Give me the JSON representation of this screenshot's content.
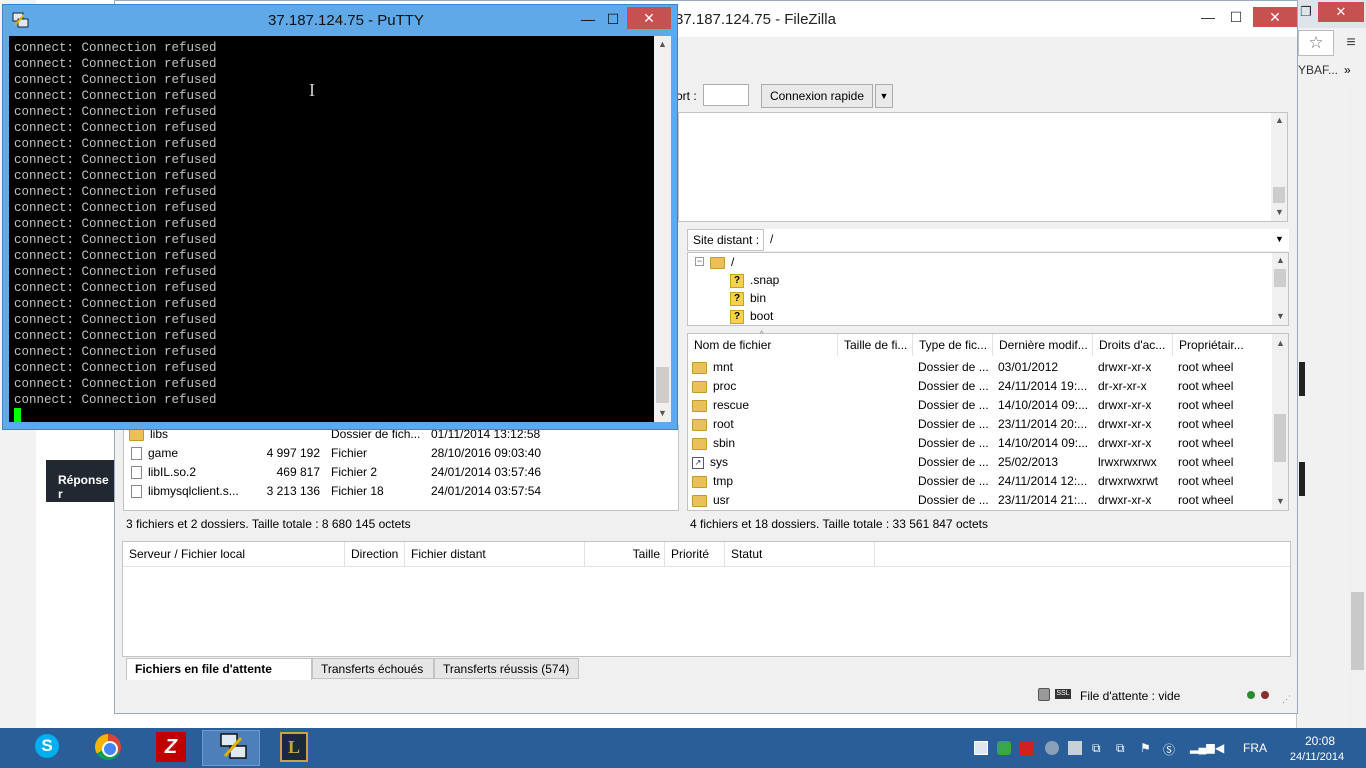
{
  "chrome": {
    "bookmark_text": "YBAF...",
    "bookmark_more": "»",
    "reply_label": "Réponse r"
  },
  "filezilla": {
    "title": "37.187.124.75 - FileZilla",
    "quickconnect": {
      "port_label": "ort :",
      "port_value": "",
      "button_label": "Connexion rapide",
      "dropdown_arrow": "▼"
    },
    "remote": {
      "site_label": "Site distant :",
      "site_path": "/",
      "tree": [
        {
          "label": "/",
          "icon": "folder-icon"
        },
        {
          "label": ".snap",
          "icon": "unknown-icon"
        },
        {
          "label": "bin",
          "icon": "unknown-icon"
        },
        {
          "label": "boot",
          "icon": "unknown-icon"
        }
      ],
      "columns": [
        "Nom de fichier",
        "Taille de fi...",
        "Type de fic...",
        "Dernière modif...",
        "Droits d'ac...",
        "Propriétair..."
      ],
      "rows": [
        {
          "name": "mnt",
          "size": "",
          "type": "Dossier de ...",
          "modified": "03/01/2012",
          "perms": "drwxr-xr-x",
          "owner": "root wheel",
          "icon": "folder-icon"
        },
        {
          "name": "proc",
          "size": "",
          "type": "Dossier de ...",
          "modified": "24/11/2014 19:...",
          "perms": "dr-xr-xr-x",
          "owner": "root wheel",
          "icon": "folder-icon"
        },
        {
          "name": "rescue",
          "size": "",
          "type": "Dossier de ...",
          "modified": "14/10/2014 09:...",
          "perms": "drwxr-xr-x",
          "owner": "root wheel",
          "icon": "folder-icon"
        },
        {
          "name": "root",
          "size": "",
          "type": "Dossier de ...",
          "modified": "23/11/2014 20:...",
          "perms": "drwxr-xr-x",
          "owner": "root wheel",
          "icon": "folder-icon"
        },
        {
          "name": "sbin",
          "size": "",
          "type": "Dossier de ...",
          "modified": "14/10/2014 09:...",
          "perms": "drwxr-xr-x",
          "owner": "root wheel",
          "icon": "folder-icon"
        },
        {
          "name": "sys",
          "size": "",
          "type": "Dossier de ...",
          "modified": "25/02/2013",
          "perms": "lrwxrwxrwx",
          "owner": "root wheel",
          "icon": "symlink-icon"
        },
        {
          "name": "tmp",
          "size": "",
          "type": "Dossier de ...",
          "modified": "24/11/2014 12:...",
          "perms": "drwxrwxrwt",
          "owner": "root wheel",
          "icon": "folder-icon"
        },
        {
          "name": "usr",
          "size": "",
          "type": "Dossier de ...",
          "modified": "23/11/2014 21:...",
          "perms": "drwxr-xr-x",
          "owner": "root wheel",
          "icon": "folder-icon"
        }
      ],
      "status": "4 fichiers et 18 dossiers. Taille totale : 33 561 847 octets"
    },
    "local": {
      "rows": [
        {
          "name": "libs",
          "size": "",
          "type": "Dossier de fich...",
          "modified": "01/11/2014 13:12:58",
          "icon": "folder-icon"
        },
        {
          "name": "game",
          "size": "4 997 192",
          "type": "Fichier",
          "modified": "28/10/2016 09:03:40",
          "icon": "file-icon"
        },
        {
          "name": "libIL.so.2",
          "size": "469 817",
          "type": "Fichier 2",
          "modified": "24/01/2014 03:57:46",
          "icon": "file-icon"
        },
        {
          "name": "libmysqlclient.s...",
          "size": "3 213 136",
          "type": "Fichier 18",
          "modified": "24/01/2014 03:57:54",
          "icon": "file-icon"
        }
      ],
      "status": "3 fichiers et 2 dossiers. Taille totale : 8 680 145 octets"
    },
    "queue": {
      "columns": [
        "Serveur / Fichier local",
        "Direction",
        "Fichier distant",
        "Taille",
        "Priorité",
        "Statut"
      ],
      "tabs": [
        "Fichiers en file d'attente",
        "Transferts échoués",
        "Transferts réussis (574)"
      ]
    },
    "statusbar": {
      "queue_label": "File d'attente : vide",
      "ssl_text": "SSL"
    }
  },
  "putty": {
    "title": "37.187.124.75 - PuTTY",
    "lines": [
      "connect: Connection refused",
      "connect: Connection refused",
      "connect: Connection refused",
      "connect: Connection refused",
      "connect: Connection refused",
      "connect: Connection refused",
      "connect: Connection refused",
      "connect: Connection refused",
      "connect: Connection refused",
      "connect: Connection refused",
      "connect: Connection refused",
      "connect: Connection refused",
      "connect: Connection refused",
      "connect: Connection refused",
      "connect: Connection refused",
      "connect: Connection refused",
      "connect: Connection refused",
      "connect: Connection refused",
      "connect: Connection refused",
      "connect: Connection refused",
      "connect: Connection refused",
      "connect: Connection refused",
      "connect: Connection refused"
    ]
  },
  "taskbar": {
    "apps": [
      {
        "name": "Skype",
        "icon": "skype-icon",
        "glyph": "S"
      },
      {
        "name": "Chrome",
        "icon": "chrome-icon"
      },
      {
        "name": "FileZilla",
        "icon": "filezilla-icon",
        "glyph": "Z"
      },
      {
        "name": "PuTTY",
        "icon": "putty-icon",
        "active": true
      },
      {
        "name": "League of Legends",
        "icon": "lol-icon",
        "glyph": "L"
      }
    ],
    "language": "FRA",
    "time": "20:08",
    "date": "24/11/2014"
  },
  "colors": {
    "putty_frame": "#5fa9e8",
    "terminal_bg": "#000000",
    "terminal_fg": "#c0c0c0",
    "cursor": "#00ff00",
    "taskbar": "#2a5e98",
    "close_button": "#c75050"
  }
}
